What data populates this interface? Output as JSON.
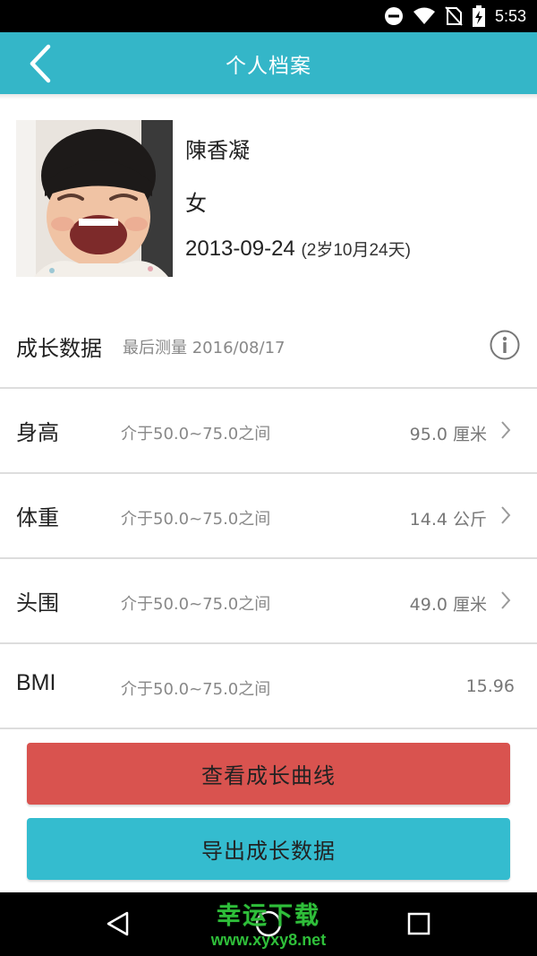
{
  "status_bar": {
    "time": "5:53",
    "icons": [
      "do-not-disturb-icon",
      "wifi-icon",
      "no-sim-icon",
      "battery-charging-icon"
    ]
  },
  "app_bar": {
    "title": "个人档案",
    "back_icon": "chevron-left-icon"
  },
  "profile": {
    "name": "陳香凝",
    "gender": "女",
    "birthdate": "2013-09-24",
    "age": "(2岁10月24天)"
  },
  "growth": {
    "title": "成长数据",
    "last_measure": "最后测量 2016/08/17",
    "info_icon": "info-icon",
    "rows": [
      {
        "label": "身高",
        "range": "介于50.0~75.0之间",
        "value": "95.0 厘米",
        "has_chevron": true
      },
      {
        "label": "体重",
        "range": "介于50.0~75.0之间",
        "value": "14.4 公斤",
        "has_chevron": true
      },
      {
        "label": "头围",
        "range": "介于50.0~75.0之间",
        "value": "49.0 厘米",
        "has_chevron": true
      },
      {
        "label": "BMI",
        "range": "介于50.0~75.0之间",
        "value": "15.96",
        "has_chevron": false
      }
    ]
  },
  "buttons": {
    "view_curve": "查看成长曲线",
    "export_data": "导出成长数据"
  },
  "colors": {
    "app_bar": "#34b6c8",
    "view_curve_button": "#d9534f",
    "export_button": "#34bccf"
  },
  "watermark": {
    "title": "幸运下载",
    "url": "www.xyxy8.net"
  }
}
